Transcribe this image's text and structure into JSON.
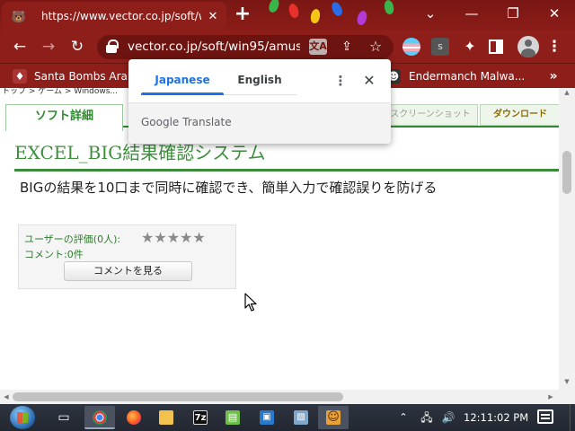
{
  "browser": {
    "tab": {
      "title": "https://www.vector.co.jp/soft/win",
      "favicon_icon": "bear-face-icon"
    },
    "new_tab_label": "+",
    "window_controls": {
      "minimize": "⌄",
      "minimize_window": "—",
      "restore": "❐",
      "close": "✕"
    },
    "toolbar": {
      "back_icon": "←",
      "forward_icon": "→",
      "reload_icon": "↻",
      "url": "vector.co.jp/soft/win95/amus...",
      "translate_icon_label": "文A",
      "share_icon": "⇪",
      "star_icon": "☆",
      "extension_s_label": "s",
      "puzzle_icon": "✦",
      "menu_icon": "⋮"
    },
    "bookmarks": {
      "items": [
        {
          "label": "Santa Bombs Arabs",
          "icon": "bookmark-favicon-icon"
        },
        {
          "label": "Endermanch Malwa...",
          "icon": "bookmark-favicon-icon"
        }
      ],
      "more_icon": "»"
    }
  },
  "page": {
    "breadcrumb": "トップ > ゲーム > Windows...",
    "tabs": {
      "detail": "ソフト詳細",
      "screenshot": "スクリーンショット",
      "download": "ダウンロード"
    },
    "title": "EXCEL_BIG結果確認システム",
    "subtitle": "BIGの結果を10口まで同時に確認でき、簡単入力で確認誤りを防げる",
    "rating": {
      "label": "ユーザーの評価(0人):",
      "stars": "★★★★★",
      "comment_label": "コメント:0件",
      "view_comments_button": "コメントを見る"
    }
  },
  "translate_popup": {
    "tab_japanese": "Japanese",
    "tab_english": "English",
    "menu_icon": "⋮",
    "close_icon": "✕",
    "brand": "Google Translate"
  },
  "taskbar": {
    "clock": "12:11:02 PM",
    "tray_caret": "⌃",
    "apps": [
      {
        "name": "task-view",
        "glyph": "▭"
      },
      {
        "name": "chrome",
        "glyph": "◉"
      },
      {
        "name": "firefox",
        "glyph": "◕"
      },
      {
        "name": "file-explorer",
        "glyph": "▬"
      },
      {
        "name": "7zip",
        "glyph": "7z"
      },
      {
        "name": "notepad-plus",
        "glyph": "▤"
      },
      {
        "name": "window-app",
        "glyph": "▣"
      },
      {
        "name": "monitor-app",
        "glyph": "▧"
      },
      {
        "name": "face-app",
        "glyph": "☺"
      }
    ]
  },
  "colors": {
    "browser_frame": "#8d1e1a",
    "accent_green": "#2f8a2f",
    "translate_blue": "#1a73e8"
  }
}
